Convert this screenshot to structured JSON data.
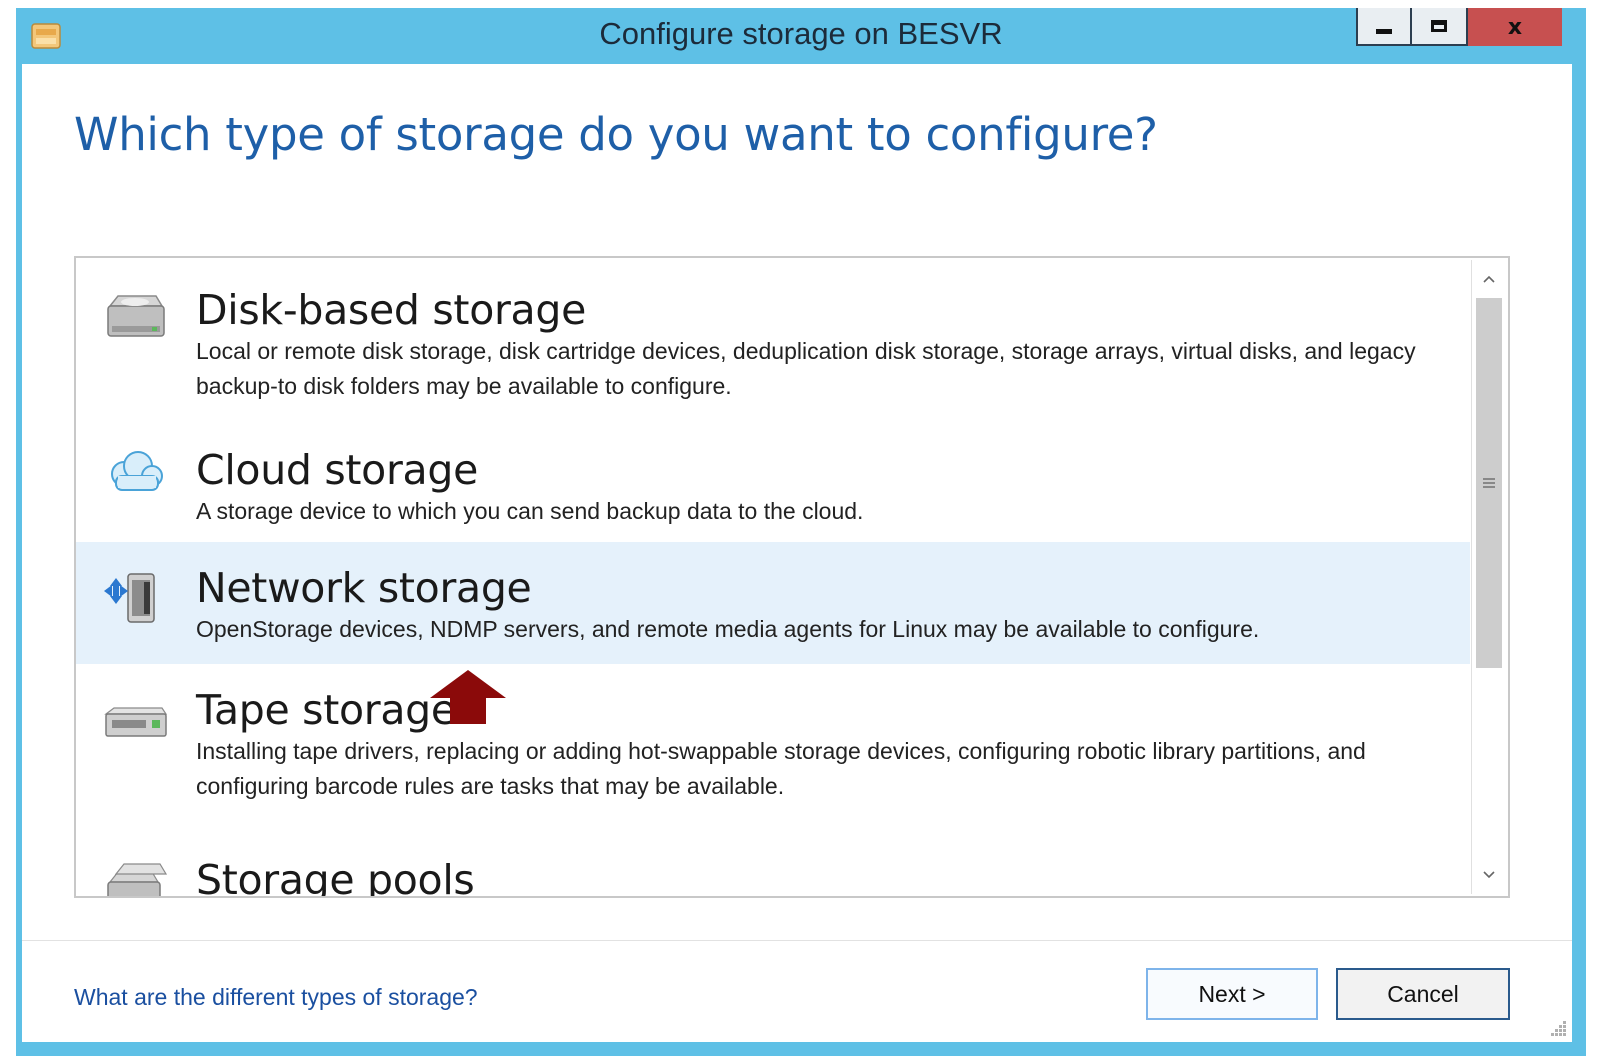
{
  "window": {
    "title": "Configure storage on BESVR",
    "controls": {
      "minimize": "minimize-icon",
      "maximize": "maximize-icon",
      "close": "x"
    }
  },
  "page": {
    "question": "Which type of storage do you want to configure?"
  },
  "storage_types": [
    {
      "title": "Disk-based storage",
      "description": "Local or remote disk storage, disk cartridge devices, deduplication disk storage, storage arrays, virtual disks, and legacy backup-to disk folders may be available to configure.",
      "icon": "hard-disk-icon",
      "selected": false
    },
    {
      "title": "Cloud storage",
      "description": "A storage device to which you can send backup data to the cloud.",
      "icon": "cloud-icon",
      "selected": false
    },
    {
      "title": "Network storage",
      "description": "OpenStorage devices, NDMP servers, and remote media agents for Linux may be available to configure.",
      "icon": "network-server-icon",
      "selected": true
    },
    {
      "title": "Tape storage",
      "description": "Installing tape drivers, replacing or adding hot-swappable storage devices, configuring robotic library partitions, and configuring barcode rules are tasks that may be available.",
      "icon": "tape-drive-icon",
      "selected": false
    },
    {
      "title": "Storage pools",
      "description": "",
      "icon": "storage-pool-icon",
      "selected": false
    }
  ],
  "footer": {
    "help_link": "What are the different types of storage?",
    "next_label": "Next >",
    "cancel_label": "Cancel"
  },
  "colors": {
    "titlebar": "#5ec0e6",
    "question_text": "#1e5fa8",
    "selected_row": "#e5f1fb",
    "close_button": "#c75050",
    "annotation_arrow": "#8b0a0a"
  }
}
